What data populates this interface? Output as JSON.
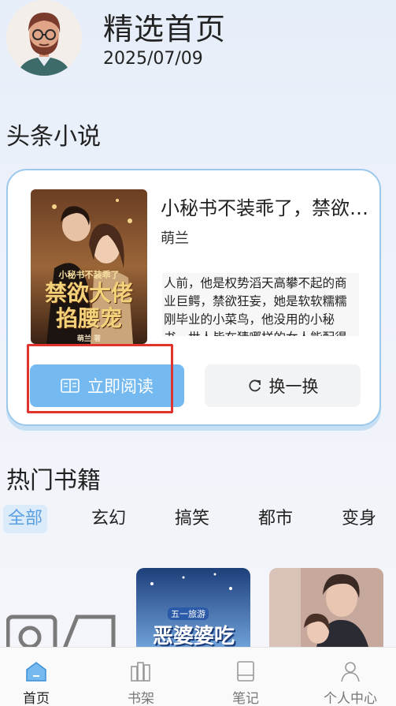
{
  "header": {
    "title": "精选首页",
    "date": "2025/07/09"
  },
  "headline": {
    "section_title": "头条小说",
    "book": {
      "title": "小秘书不装乖了，禁欲大佬掐腰宠",
      "author": "萌兰",
      "description": "人前，他是权势滔天高攀不起的商业巨鳄，禁欲狂妄，她是软软糯糯刚毕业的小菜鸟，他没用的小秘书。世人皆在猜哪样的女人能配得",
      "cover_title_line1": "小秘书不装乖了",
      "cover_title_line2": "禁欲大佬",
      "cover_title_line3": "掐腰宠",
      "cover_author": "萌兰 著"
    },
    "read_button": "立即阅读",
    "change_button": "换一换"
  },
  "hot": {
    "section_title": "热门书籍",
    "tabs": [
      "全部",
      "玄幻",
      "搞笑",
      "都市",
      "变身"
    ],
    "active_tab": 0,
    "thumb2_banner": "五一旅游",
    "thumb2_title": "恶婆婆吃"
  },
  "nav": {
    "items": [
      {
        "label": "首页",
        "icon": "home-icon"
      },
      {
        "label": "书架",
        "icon": "bookshelf-icon"
      },
      {
        "label": "笔记",
        "icon": "notes-icon"
      },
      {
        "label": "个人中心",
        "icon": "user-icon"
      }
    ],
    "active": 0
  },
  "colors": {
    "accent": "#74b9ef",
    "highlight": "#e0332e"
  }
}
